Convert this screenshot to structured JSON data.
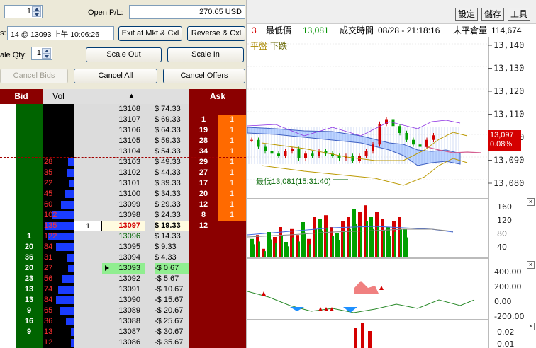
{
  "order_entry": {
    "qty_value": "1",
    "open_pl_label": "Open P/L:",
    "open_pl_value": "270.65 USD",
    "position_label_fragment": "s:",
    "position_value": "14 @ 13093 上午 10:06:26",
    "exit_button": "Exit at Mkt & Cxl",
    "reverse_button": "Reverse & Cxl",
    "scale_qty_label": "ale Qty:",
    "scale_qty_value": "1",
    "scale_out_button": "Scale Out",
    "scale_in_button": "Scale In",
    "cancel_bids_button": "Cancel Bids",
    "cancel_all_button": "Cancel All",
    "cancel_offers_button": "Cancel Offers"
  },
  "ladder": {
    "headers": {
      "bid": "Bid",
      "vol": "Vol",
      "sort_arrow": "▲",
      "ask": "Ask"
    },
    "rows": [
      {
        "price": "13108",
        "pl": "$ 74.33",
        "bid": "",
        "vol": "",
        "ask": "",
        "ask_orders": ""
      },
      {
        "price": "13107",
        "pl": "$ 69.33",
        "bid": "",
        "vol": "",
        "ask": "1",
        "ask_orders": "1"
      },
      {
        "price": "13106",
        "pl": "$ 64.33",
        "bid": "",
        "vol": "",
        "ask": "19",
        "ask_orders": "1"
      },
      {
        "price": "13105",
        "pl": "$ 59.33",
        "bid": "",
        "vol": "",
        "ask": "28",
        "ask_orders": "1"
      },
      {
        "price": "13104",
        "pl": "$ 54.33",
        "bid": "",
        "vol": "",
        "ask": "34",
        "ask_orders": "1"
      },
      {
        "price": "13103",
        "pl": "$ 49.33",
        "bid": "",
        "vol": "28",
        "ask": "29",
        "ask_orders": "1"
      },
      {
        "price": "13102",
        "pl": "$ 44.33",
        "bid": "",
        "vol": "35",
        "ask": "27",
        "ask_orders": "1"
      },
      {
        "price": "13101",
        "pl": "$ 39.33",
        "bid": "",
        "vol": "22",
        "ask": "17",
        "ask_orders": "1"
      },
      {
        "price": "13100",
        "pl": "$ 34.33",
        "bid": "",
        "vol": "45",
        "ask": "20",
        "ask_orders": "1"
      },
      {
        "price": "13099",
        "pl": "$ 29.33",
        "bid": "",
        "vol": "60",
        "ask": "12",
        "ask_orders": "1"
      },
      {
        "price": "13098",
        "pl": "$ 24.33",
        "bid": "",
        "vol": "102",
        "ask": "8",
        "ask_orders": "1"
      },
      {
        "price": "13097",
        "pl": "$ 19.33",
        "bid": "",
        "vol": "135",
        "ask": "12",
        "ask_orders": "",
        "last": "1"
      },
      {
        "price": "13096",
        "pl": "$ 14.33",
        "bid": "1",
        "vol": "122",
        "ask": "",
        "ask_orders": ""
      },
      {
        "price": "13095",
        "pl": "$ 9.33",
        "bid": "20",
        "vol": "84",
        "ask": "",
        "ask_orders": ""
      },
      {
        "price": "13094",
        "pl": "$ 4.33",
        "bid": "36",
        "vol": "31",
        "ask": "",
        "ask_orders": ""
      },
      {
        "price": "13093",
        "pl": "-$ 0.67",
        "bid": "20",
        "vol": "27",
        "ask": "",
        "ask_orders": ""
      },
      {
        "price": "13092",
        "pl": "-$ 5.67",
        "bid": "23",
        "vol": "56",
        "ask": "",
        "ask_orders": ""
      },
      {
        "price": "13091",
        "pl": "-$ 10.67",
        "bid": "13",
        "vol": "74",
        "ask": "",
        "ask_orders": ""
      },
      {
        "price": "13090",
        "pl": "-$ 15.67",
        "bid": "13",
        "vol": "84",
        "ask": "",
        "ask_orders": ""
      },
      {
        "price": "13089",
        "pl": "-$ 20.67",
        "bid": "9",
        "vol": "65",
        "ask": "",
        "ask_orders": ""
      },
      {
        "price": "13088",
        "pl": "-$ 25.67",
        "bid": "16",
        "vol": "36",
        "ask": "",
        "ask_orders": ""
      },
      {
        "price": "13087",
        "pl": "-$ 30.67",
        "bid": "9",
        "vol": "13",
        "ask": "",
        "ask_orders": ""
      },
      {
        "price": "13086",
        "pl": "-$ 35.67",
        "bid": "",
        "vol": "12",
        "ask": "",
        "ask_orders": ""
      }
    ]
  },
  "chart": {
    "toolbar": {
      "settings": "設定",
      "save": "儲存",
      "tools": "工具"
    },
    "info": {
      "frag": "3",
      "low_label": "最低價",
      "low_value": "13,081",
      "time_label": "成交時間",
      "time_value": "08/28 - 21:18:16",
      "oi_label": "未平倉量",
      "oi_value": "114,674"
    },
    "legend": {
      "flat": "平盤",
      "down": "下跌"
    },
    "price_axis": [
      "13,140",
      "13,130",
      "13,120",
      "13,110",
      "13,100",
      "13,090",
      "13,080"
    ],
    "last_price_badge": "13,097",
    "change_badge": "0.08%",
    "low_annotation": "最低13,081(15:31:40)",
    "volume_axis": [
      "160",
      "120",
      "80",
      "40"
    ],
    "osc_axis": [
      "400.00",
      "200.00",
      "0.00",
      "-200.00"
    ],
    "bottom_axis": [
      "0.02",
      "0.01"
    ],
    "colors": {
      "up": "#d40000",
      "down": "#00a000",
      "ask": "#8b0000",
      "bid": "#006400",
      "ask_orange": "#ff6a00"
    }
  }
}
